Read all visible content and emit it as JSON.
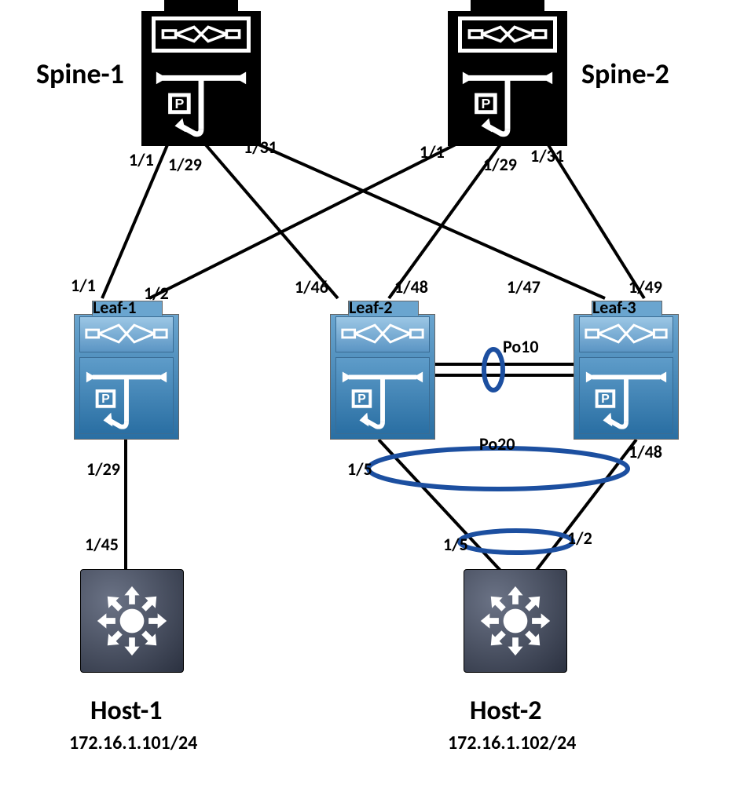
{
  "devices": {
    "spine1": {
      "name": "Spine-1",
      "ports": {
        "p1": "1/1",
        "p29": "1/29",
        "p31": "1/31"
      }
    },
    "spine2": {
      "name": "Spine-2",
      "ports": {
        "p1": "1/1",
        "p29": "1/29",
        "p31": "1/31"
      }
    },
    "leaf1": {
      "name": "Leaf-1",
      "ports": {
        "p1": "1/1",
        "p2": "1/2",
        "p29": "1/29"
      }
    },
    "leaf2": {
      "name": "Leaf-2",
      "ports": {
        "p46": "1/46",
        "p48": "1/48",
        "p5": "1/5"
      }
    },
    "leaf3": {
      "name": "Leaf-3",
      "ports": {
        "p47": "1/47",
        "p49": "1/49",
        "p48": "1/48"
      }
    },
    "host1": {
      "name": "Host-1",
      "ip": "172.16.1.101/24",
      "ports": {
        "p45": "1/45"
      }
    },
    "host2": {
      "name": "Host-2",
      "ip": "172.16.1.102/24",
      "ports": {
        "p5": "1/5",
        "p2": "1/2"
      }
    }
  },
  "port_channels": {
    "po10": "Po10",
    "po20": "Po20"
  }
}
